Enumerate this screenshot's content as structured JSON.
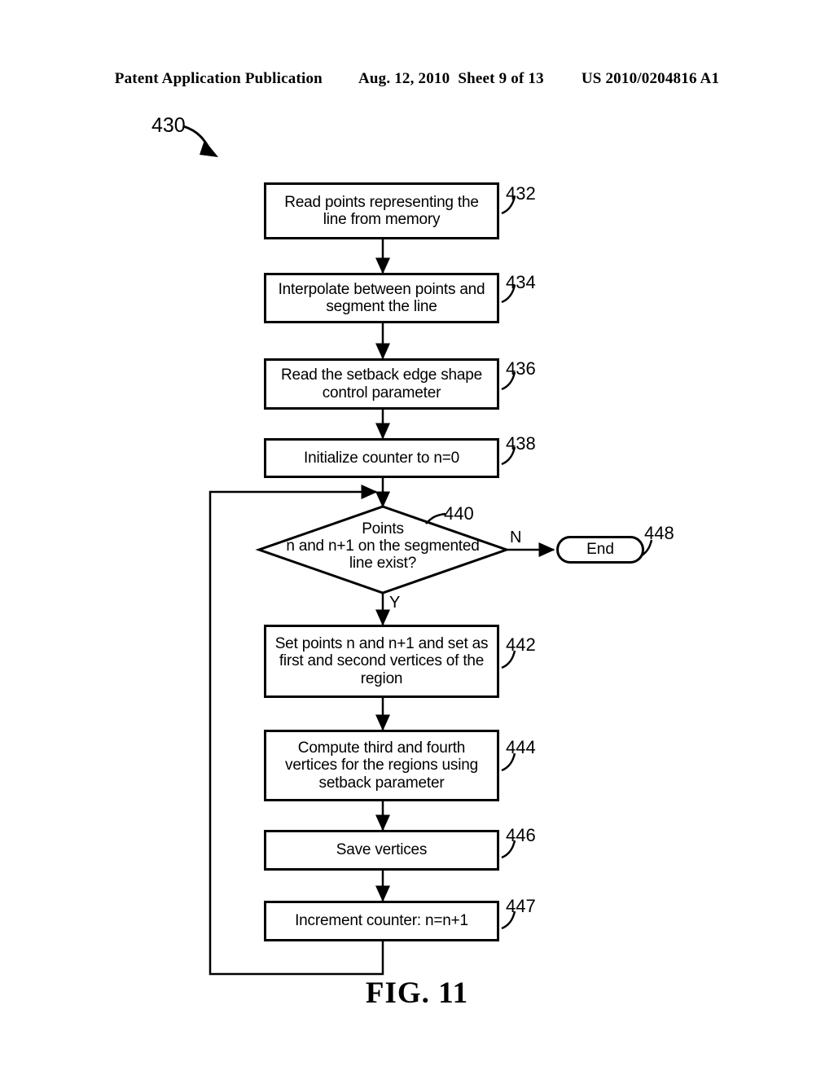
{
  "header": {
    "publication": "Patent Application Publication",
    "date": "Aug. 12, 2010",
    "sheet": "Sheet 9 of 13",
    "patent_number": "US 2010/0204816 A1"
  },
  "figure": {
    "caption": "FIG. 11",
    "diagram_ref": "430"
  },
  "flowchart": {
    "nodes": [
      {
        "ref": "432",
        "text": "Read points representing the line from memory",
        "shape": "process"
      },
      {
        "ref": "434",
        "text": "Interpolate between points and segment the line",
        "shape": "process"
      },
      {
        "ref": "436",
        "text": "Read the setback edge shape control parameter",
        "shape": "process"
      },
      {
        "ref": "438",
        "text": "Initialize counter to n=0",
        "shape": "process"
      },
      {
        "ref": "440",
        "text": "Points n and n+1 on the segmented line exist?",
        "shape": "decision"
      },
      {
        "ref": "448",
        "text": "End",
        "shape": "terminator"
      },
      {
        "ref": "442",
        "text": "Set points n and n+1 and set as first and second vertices of the region",
        "shape": "process"
      },
      {
        "ref": "444",
        "text": "Compute third and fourth vertices for the regions using setback parameter",
        "shape": "process"
      },
      {
        "ref": "446",
        "text": "Save vertices",
        "shape": "process"
      },
      {
        "ref": "447",
        "text": "Increment counter:  n=n+1",
        "shape": "process"
      }
    ],
    "decision_lines": {
      "line1": "Points",
      "line2": "n and n+1 on the segmented",
      "line3": "line exist?"
    },
    "branch_labels": {
      "no": "N",
      "yes": "Y"
    },
    "node_text": {
      "n432_l1": "Read points representing the",
      "n432_l2": "line from memory",
      "n434_l1": "Interpolate between points and",
      "n434_l2": "segment the line",
      "n436_l1": "Read the setback edge shape",
      "n436_l2": "control parameter",
      "n438_l1": "Initialize counter to n=0",
      "n442_l1": "Set points n and n+1 and set as",
      "n442_l2": "first and second vertices of the",
      "n442_l3": "region",
      "n444_l1": "Compute third and fourth",
      "n444_l2": "vertices for the regions using",
      "n444_l3": "setback parameter",
      "n446_l1": "Save vertices",
      "n447_l1": "Increment counter:  n=n+1",
      "n448_l1": "End"
    },
    "refs": {
      "r430": "430",
      "r432": "432",
      "r434": "434",
      "r436": "436",
      "r438": "438",
      "r440": "440",
      "r442": "442",
      "r444": "444",
      "r446": "446",
      "r447": "447",
      "r448": "448"
    },
    "colors": {
      "stroke": "#000000",
      "fill": "#ffffff"
    }
  }
}
